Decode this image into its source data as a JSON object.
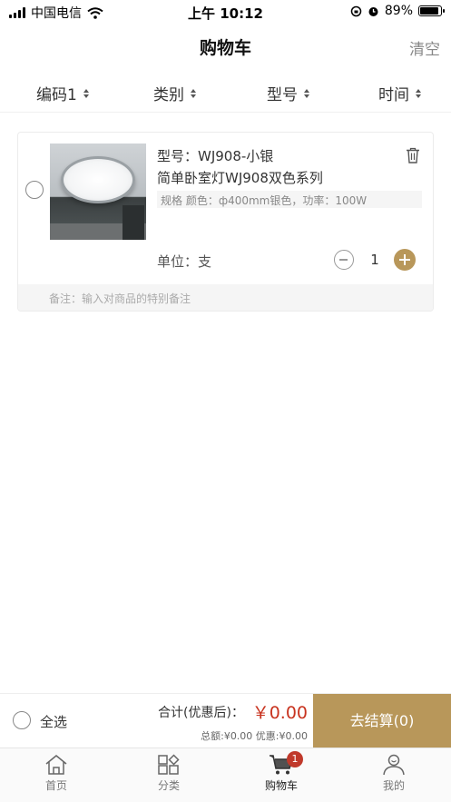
{
  "status_bar": {
    "carrier": "中国电信",
    "time": "上午 10:12",
    "battery": "89%"
  },
  "nav": {
    "title": "购物车",
    "clear_label": "清空"
  },
  "sort_bar": {
    "items": [
      {
        "label": "编码1"
      },
      {
        "label": "类别"
      },
      {
        "label": "型号"
      },
      {
        "label": "时间"
      }
    ]
  },
  "cart": {
    "items": [
      {
        "model": "型号：WJ908-小银",
        "name": "简单卧室灯WJ908双色系列",
        "spec": "规格 颜色：ф400mm银色，功率：100W",
        "unit": "单位：支",
        "quantity": "1",
        "remark_placeholder": "备注：输入对商品的特别备注"
      }
    ]
  },
  "checkout": {
    "select_all_label": "全选",
    "total_label": "合计(优惠后)：",
    "total_amount": "￥0.00",
    "total_detail": "总额:¥0.00 优惠:¥0.00",
    "checkout_button": "去结算(0)"
  },
  "tab_bar": {
    "tabs": [
      {
        "label": "首页",
        "icon": "home-icon"
      },
      {
        "label": "分类",
        "icon": "category-icon"
      },
      {
        "label": "购物车",
        "icon": "cart-icon",
        "badge": "1",
        "active": true
      },
      {
        "label": "我的",
        "icon": "profile-icon"
      }
    ]
  },
  "colors": {
    "accent": "#b8975a",
    "price": "#c8331f",
    "badge": "#c0392b"
  }
}
